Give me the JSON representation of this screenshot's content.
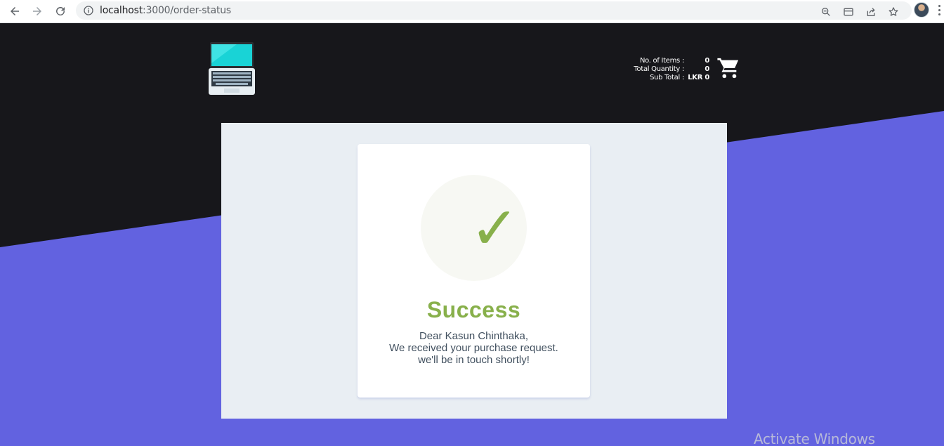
{
  "browser": {
    "url_host": "localhost",
    "url_path": ":3000/order-status"
  },
  "colors": {
    "header_dark": "#17171b",
    "accent_purple": "#6262e0",
    "panel_bg": "#e9eef3",
    "success_green": "#88b04b",
    "message_text": "#404f5e"
  },
  "header": {
    "logo_icon": "laptop-icon",
    "cart_icon": "shopping-cart-icon",
    "summary": [
      {
        "label": "No. of Items",
        "colon": ":",
        "value": "0"
      },
      {
        "label": "Total Quantity",
        "colon": ":",
        "value": "0"
      },
      {
        "label": "Sub Total",
        "colon": ":",
        "value": "LKR 0"
      }
    ]
  },
  "status_card": {
    "icon": "checkmark-icon",
    "check_glyph": "✓",
    "title": "Success",
    "message_lines": [
      "Dear Kasun Chinthaka,",
      "We received your purchase request.",
      "we'll be in touch shortly!"
    ]
  },
  "system_watermark": "Activate Windows"
}
